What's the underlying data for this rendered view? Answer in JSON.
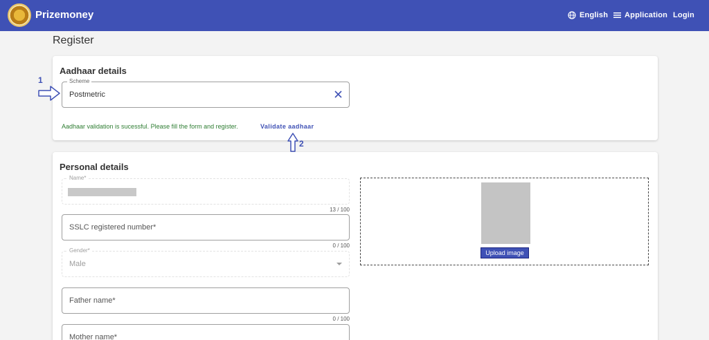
{
  "header": {
    "brand": "Prizemoney",
    "nav": {
      "english_label": "English",
      "application_label": "Application",
      "login_label": "Login"
    },
    "colors": {
      "bar": "#3f51b5"
    }
  },
  "page": {
    "title": "Register"
  },
  "aadhaar": {
    "title": "Aadhaar details",
    "scheme": {
      "label": "Scheme",
      "value": "Postmetric"
    },
    "success_message": "Aadhaar validation is sucessful. Please fill the form and register.",
    "validate_label": "Validate aadhaar",
    "annotations": {
      "one": "1",
      "two": "2"
    }
  },
  "personal": {
    "title": "Personal details",
    "name": {
      "label": "Name*",
      "counter": "13 / 100"
    },
    "sslc": {
      "placeholder": "SSLC registered number*",
      "counter": "0 / 100"
    },
    "gender": {
      "label": "Gender*",
      "value": "Male"
    },
    "father": {
      "placeholder": "Father name*",
      "counter": "0 / 100"
    },
    "mother": {
      "placeholder": "Mother name*"
    },
    "upload_label": "Upload image"
  }
}
